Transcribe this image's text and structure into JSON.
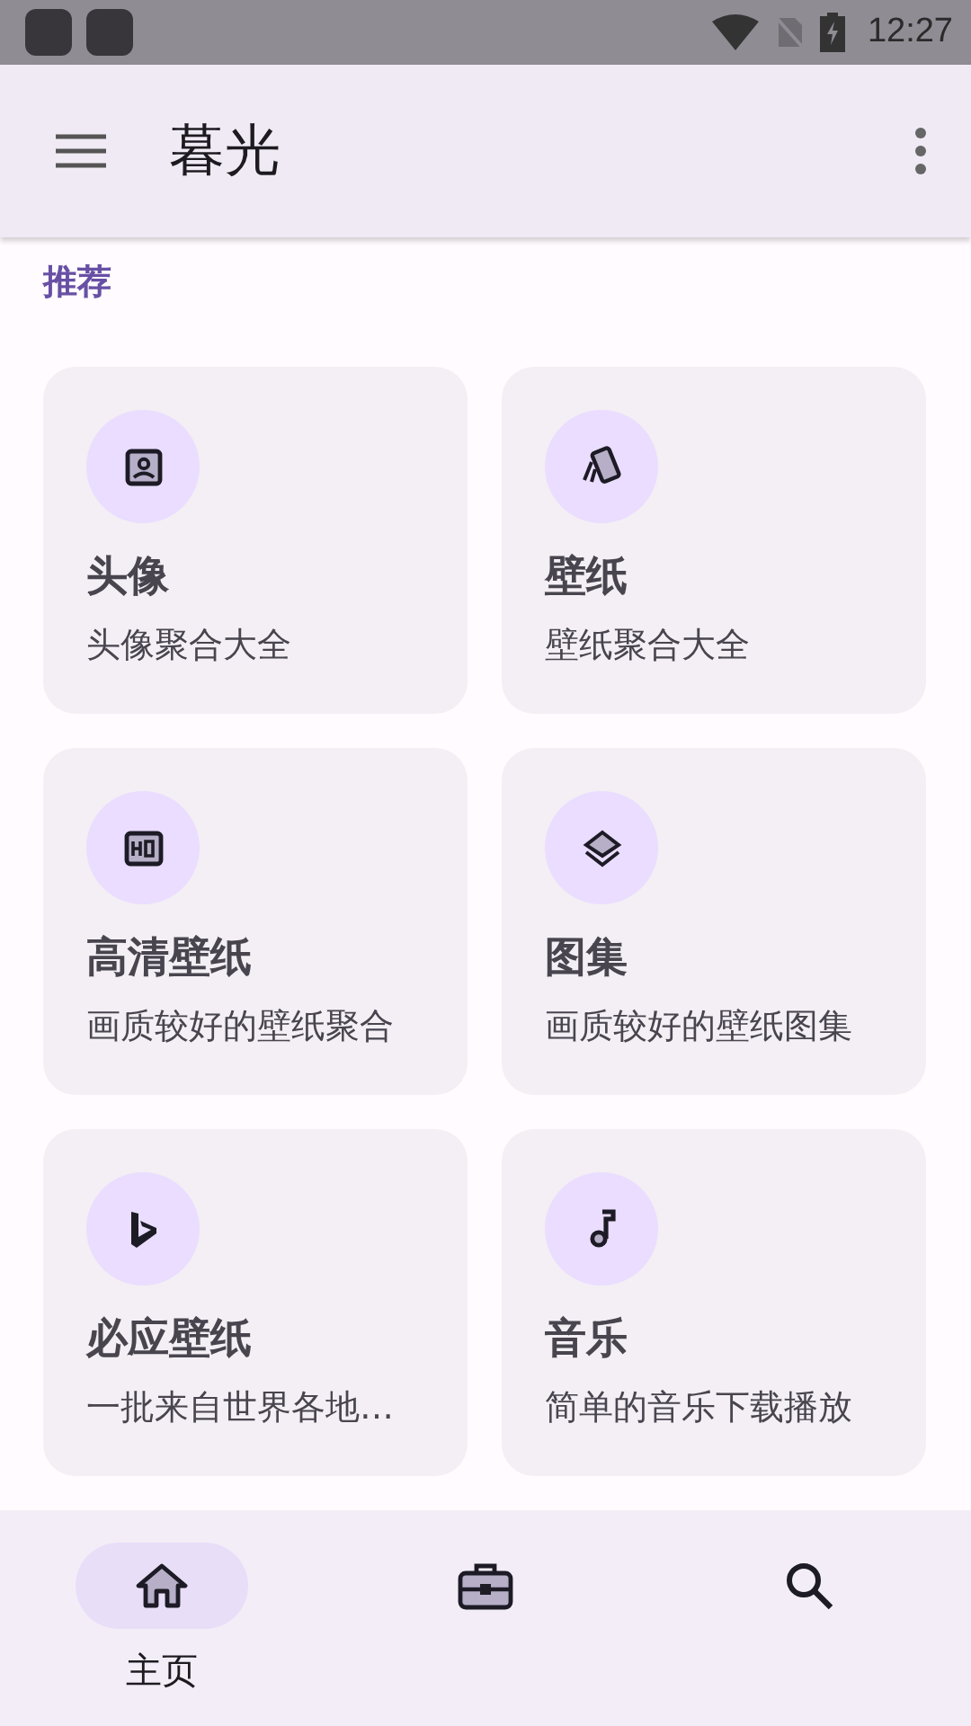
{
  "status_bar": {
    "time": "12:27"
  },
  "app_bar": {
    "title": "暮光"
  },
  "section": {
    "title": "推荐"
  },
  "cards": [
    {
      "kind": "portrait",
      "title": "头像",
      "subtitle": "头像聚合大全"
    },
    {
      "kind": "cards",
      "title": "壁纸",
      "subtitle": "壁纸聚合大全"
    },
    {
      "kind": "hd",
      "title": "高清壁纸",
      "subtitle": "画质较好的壁纸聚合"
    },
    {
      "kind": "layers",
      "title": "图集",
      "subtitle": "画质较好的壁纸图集"
    },
    {
      "kind": "bing",
      "title": "必应壁纸",
      "subtitle": "一批来自世界各地…"
    },
    {
      "kind": "music",
      "title": "音乐",
      "subtitle": "简单的音乐下载播放"
    }
  ],
  "bottom_nav": [
    {
      "kind": "home",
      "label": "主页",
      "selected": true
    },
    {
      "kind": "briefcase",
      "selected": false
    },
    {
      "kind": "search",
      "selected": false
    }
  ]
}
